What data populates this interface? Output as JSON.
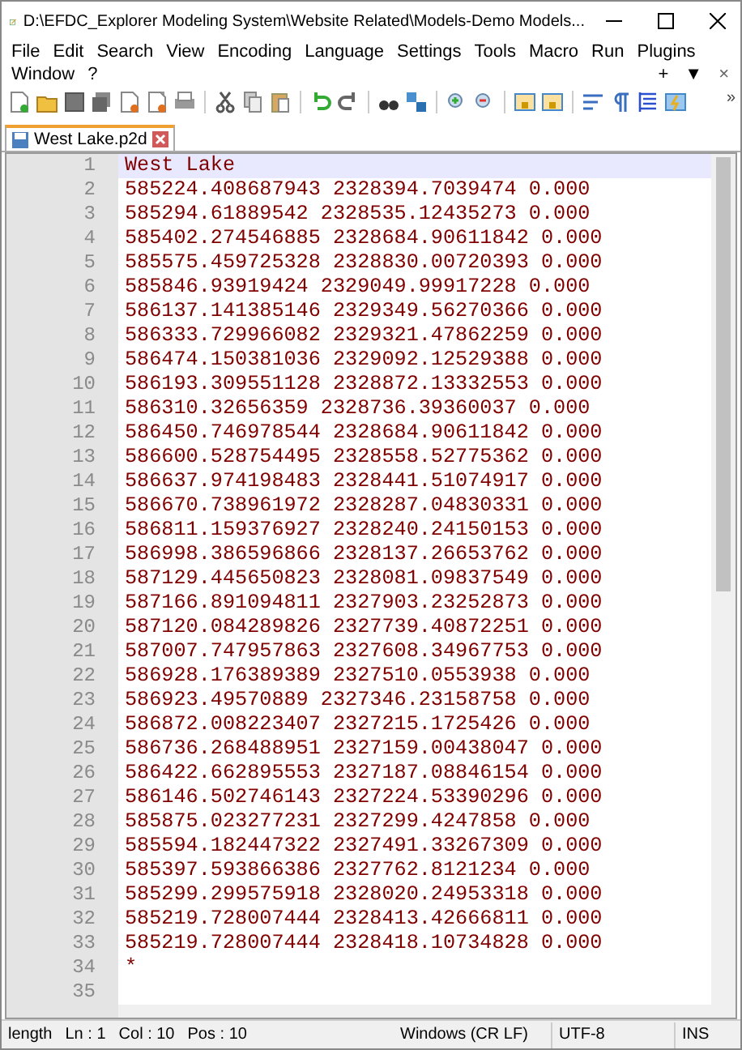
{
  "window": {
    "title": "D:\\EFDC_Explorer Modeling System\\Website Related\\Models-Demo Models..."
  },
  "menu": {
    "items": [
      "File",
      "Edit",
      "Search",
      "View",
      "Encoding",
      "Language",
      "Settings",
      "Tools",
      "Macro",
      "Run",
      "Plugins",
      "Window",
      "?"
    ],
    "doc_controls": [
      "+",
      "▼",
      "×"
    ]
  },
  "toolbar": {
    "overflow": "»"
  },
  "tabs": [
    {
      "label": "West Lake.p2d",
      "selected": true
    }
  ],
  "editor": {
    "lines": [
      {
        "number": "1",
        "text": "West Lake",
        "current": true
      },
      {
        "number": "2",
        "text": "585224.408687943 2328394.7039474 0.000",
        "current": false
      },
      {
        "number": "3",
        "text": "585294.61889542 2328535.12435273 0.000",
        "current": false
      },
      {
        "number": "4",
        "text": "585402.274546885 2328684.90611842 0.000",
        "current": false
      },
      {
        "number": "5",
        "text": "585575.459725328 2328830.00720393 0.000",
        "current": false
      },
      {
        "number": "6",
        "text": "585846.93919424 2329049.99917228 0.000",
        "current": false
      },
      {
        "number": "7",
        "text": "586137.141385146 2329349.56270366 0.000",
        "current": false
      },
      {
        "number": "8",
        "text": "586333.729966082 2329321.47862259 0.000",
        "current": false
      },
      {
        "number": "9",
        "text": "586474.150381036 2329092.12529388 0.000",
        "current": false
      },
      {
        "number": "10",
        "text": "586193.309551128 2328872.13332553 0.000",
        "current": false
      },
      {
        "number": "11",
        "text": "586310.32656359 2328736.39360037 0.000",
        "current": false
      },
      {
        "number": "12",
        "text": "586450.746978544 2328684.90611842 0.000",
        "current": false
      },
      {
        "number": "13",
        "text": "586600.528754495 2328558.52775362 0.000",
        "current": false
      },
      {
        "number": "14",
        "text": "586637.974198483 2328441.51074917 0.000",
        "current": false
      },
      {
        "number": "15",
        "text": "586670.738961972 2328287.04830331 0.000",
        "current": false
      },
      {
        "number": "16",
        "text": "586811.159376927 2328240.24150153 0.000",
        "current": false
      },
      {
        "number": "17",
        "text": "586998.386596866 2328137.26653762 0.000",
        "current": false
      },
      {
        "number": "18",
        "text": "587129.445650823 2328081.09837549 0.000",
        "current": false
      },
      {
        "number": "19",
        "text": "587166.891094811 2327903.23252873 0.000",
        "current": false
      },
      {
        "number": "20",
        "text": "587120.084289826 2327739.40872251 0.000",
        "current": false
      },
      {
        "number": "21",
        "text": "587007.747957863 2327608.34967753 0.000",
        "current": false
      },
      {
        "number": "22",
        "text": "586928.176389389 2327510.0553938 0.000",
        "current": false
      },
      {
        "number": "23",
        "text": "586923.49570889 2327346.23158758 0.000",
        "current": false
      },
      {
        "number": "24",
        "text": "586872.008223407 2327215.1725426 0.000",
        "current": false
      },
      {
        "number": "25",
        "text": "586736.268488951 2327159.00438047 0.000",
        "current": false
      },
      {
        "number": "26",
        "text": "586422.662895553 2327187.08846154 0.000",
        "current": false
      },
      {
        "number": "27",
        "text": "586146.502746143 2327224.53390296 0.000",
        "current": false
      },
      {
        "number": "28",
        "text": "585875.023277231 2327299.4247858 0.000",
        "current": false
      },
      {
        "number": "29",
        "text": "585594.182447322 2327491.33267309 0.000",
        "current": false
      },
      {
        "number": "30",
        "text": "585397.593866386 2327762.8121234 0.000",
        "current": false
      },
      {
        "number": "31",
        "text": "585299.299575918 2328020.24953318 0.000",
        "current": false
      },
      {
        "number": "32",
        "text": "585219.728007444 2328413.42666811 0.000",
        "current": false
      },
      {
        "number": "33",
        "text": "585219.728007444 2328418.10734828 0.000",
        "current": false
      },
      {
        "number": "34",
        "text": "*",
        "current": false
      },
      {
        "number": "35",
        "current": false
      }
    ]
  },
  "status_bar": {
    "left": [
      "length",
      "Ln : 1",
      "Col : 10",
      "Pos : 10"
    ],
    "eol": "Windows (CR LF)",
    "encoding": "UTF-8",
    "mode": "INS"
  }
}
